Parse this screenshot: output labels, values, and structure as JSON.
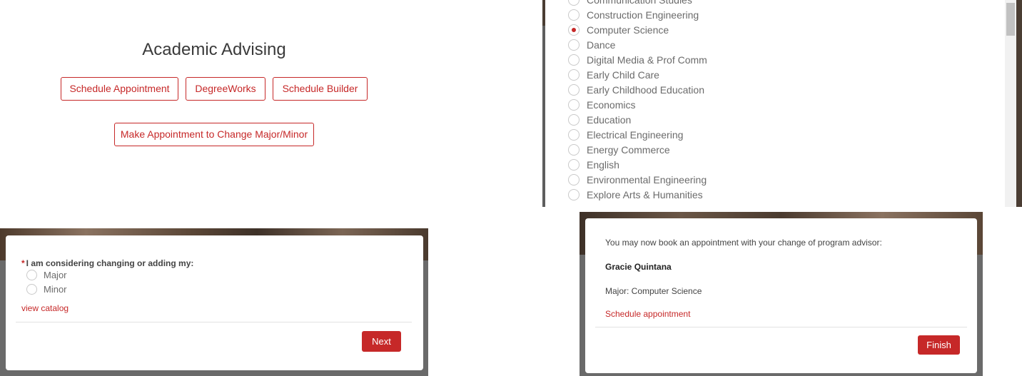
{
  "advising": {
    "title": "Academic Advising",
    "buttons": [
      "Schedule Appointment",
      "DegreeWorks",
      "Schedule Builder"
    ],
    "change_button": "Make Appointment to Change Major/Minor"
  },
  "majors": {
    "items": [
      {
        "label": "Communication Studies",
        "checked": false
      },
      {
        "label": "Construction Engineering",
        "checked": false
      },
      {
        "label": "Computer Science",
        "checked": true
      },
      {
        "label": "Dance",
        "checked": false
      },
      {
        "label": "Digital Media & Prof Comm",
        "checked": false
      },
      {
        "label": "Early Child Care",
        "checked": false
      },
      {
        "label": "Early Childhood Education",
        "checked": false
      },
      {
        "label": "Economics",
        "checked": false
      },
      {
        "label": "Education",
        "checked": false
      },
      {
        "label": "Electrical Engineering",
        "checked": false
      },
      {
        "label": "Energy Commerce",
        "checked": false
      },
      {
        "label": "English",
        "checked": false
      },
      {
        "label": "Environmental Engineering",
        "checked": false
      },
      {
        "label": "Explore Arts & Humanities",
        "checked": false
      }
    ]
  },
  "consider": {
    "required_mark": "*",
    "question": "I am considering changing or adding my:",
    "options": [
      "Major",
      "Minor"
    ],
    "catalog_link": "view catalog",
    "next_label": "Next"
  },
  "finish": {
    "message": "You may now book an appointment with your change of program advisor:",
    "advisor_name": "Gracie Quintana",
    "major_line": "Major: Computer Science",
    "schedule_link": "Schedule appointment",
    "finish_label": "Finish"
  },
  "colors": {
    "accent": "#c62828",
    "text": "#6b6b6b",
    "backdrop": "#6a6a6a"
  }
}
